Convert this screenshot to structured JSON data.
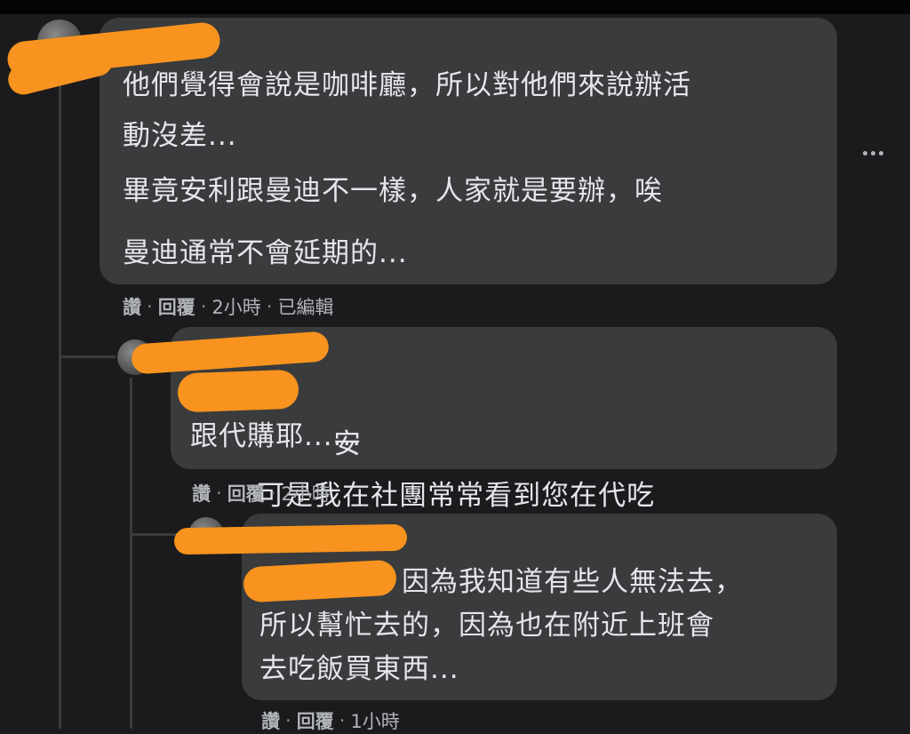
{
  "comments": [
    {
      "lines": [
        "他們覺得會說是咖啡廳，所以對他們來說辦活",
        "動沒差...",
        "畢竟安利跟曼迪不一樣，人家就是要辦，唉",
        "曼迪通常不會延期的..."
      ],
      "actions": {
        "like": "讚",
        "reply": "回覆",
        "time": "2小時",
        "edited": "已編輯"
      }
    },
    {
      "inline_name_tail": "安",
      "lines": [
        "可是我在社團常常看到您在代吃",
        "跟代購耶......"
      ],
      "actions": {
        "like": "讚",
        "reply": "回覆",
        "time": "2小時"
      }
    },
    {
      "lines": [
        "因為我知道有些人無法去，",
        "所以幫忙去的，因為也在附近上班會",
        "去吃飯買東西..."
      ],
      "actions": {
        "like": "讚",
        "reply": "回覆",
        "time": "1小時"
      }
    }
  ],
  "colors": {
    "background": "#1b1b1d",
    "bubble": "#3a3b3c",
    "text": "#e4e6eb",
    "meta": "#b0b3b8",
    "redaction": "#f7931e"
  }
}
